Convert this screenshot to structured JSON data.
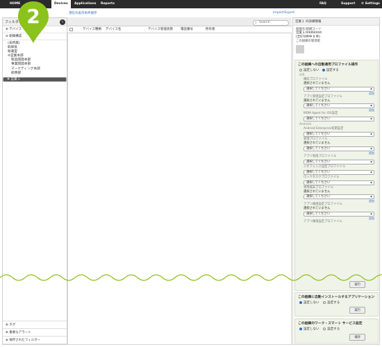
{
  "topnav": {
    "home": "HOME",
    "devices": "Devices",
    "applications": "Applications",
    "reports": "Reports",
    "faq": "FAQ",
    "support": "Support",
    "settings": "Settings"
  },
  "step_badge": "2",
  "sidebar": {
    "header": "フィルタ",
    "filter_devices": "デバイス",
    "org_label": "組織構成",
    "tree": [
      "(未所属)",
      "取締役",
      "秘書室",
      "営業本部",
      "製品開発本部",
      "事業開発本部",
      "マーケティング本部",
      "総務部",
      "営業１"
    ],
    "footer": [
      "タグ",
      "重要なアラート",
      "保存されたフィルター"
    ]
  },
  "middle": {
    "link_left": "現在の表示条件保存",
    "link_right": "Import/Export",
    "search_placeholder": "Search",
    "columns": [
      "デバイス種類",
      "デバイス名",
      "デバイス管理状態",
      "電話番号",
      "所有者"
    ]
  },
  "right": {
    "title": "営業１ の詳細情報",
    "org_name_code_label": "組織名/組織コード",
    "org_name_code": "営業１/44464444",
    "count": "(全670件中 0 件)",
    "manager_label": "この組織の管理者",
    "profile_section_title": "この組織への自動適用プロファイル操作",
    "radio_off": "設定しない",
    "radio_on": "設定する",
    "ios_label": "iOS",
    "android_label": "Android",
    "not_selected": "選択されていません",
    "select_placeholder": "選択してください",
    "add_link": "追加",
    "ios_fields": [
      "構成プロファイル",
      "アプリ管理設定プロファイル",
      "MDM Agent for iOS設定"
    ],
    "android_fields": [
      "Android Enterprise初期設定",
      "管理プロファイル",
      "アプリ制限プロファイル",
      "ジオフェンス設定プロファイル",
      "ロックタスクプロファイル",
      "専用端末プロファイル",
      "アプリ権限設定プロファイル",
      "アプリ権限設定プロファイル"
    ],
    "run_button": "実行",
    "apps_title": "この組織に自動インストールするアプリケーション",
    "apps_radio_off": "設定しない",
    "apps_radio_on": "設定する",
    "apps_run": "実行",
    "work_title": "この組織のワーク・スマート サービス設定",
    "work_radio_off": "設定しない",
    "work_radio_on": "設定する",
    "save_button": "保存"
  },
  "colors": {
    "nav_bg": "#2b2b2b",
    "pin": "#8cc21c",
    "panel_bg": "#f0f3e8",
    "link": "#2a6dc0"
  }
}
